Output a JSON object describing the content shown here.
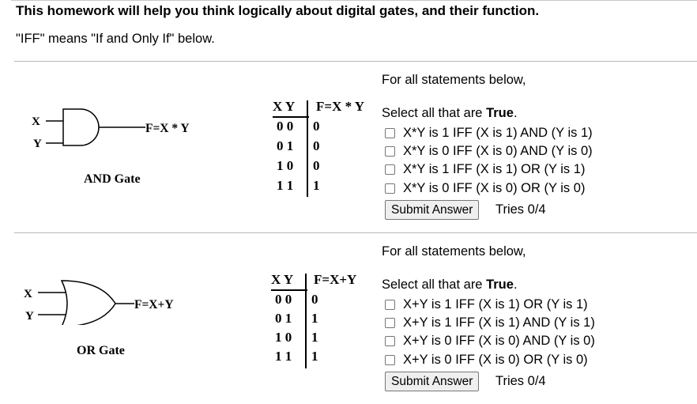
{
  "header": {
    "title": "This homework will help you think logically about digital gates, and their function.",
    "iff_note": "\"IFF\" means \"If and Only If\" below."
  },
  "problems": [
    {
      "gate_label": "AND Gate",
      "input_x": "X",
      "input_y": "Y",
      "output_label": "F=X * Y",
      "truth_table": {
        "header_inputs": "X Y",
        "header_output": "F=X * Y",
        "rows": [
          {
            "inputs": "0 0",
            "output": "0"
          },
          {
            "inputs": "0 1",
            "output": "0"
          },
          {
            "inputs": "1 0",
            "output": "0"
          },
          {
            "inputs": "1 1",
            "output": "1"
          }
        ]
      },
      "intro": "For all statements below,",
      "prompt_prefix": "Select all that are ",
      "prompt_bold": "True",
      "prompt_suffix": ".",
      "options": [
        "X*Y is 1 IFF (X is 1) AND (Y is 1)",
        "X*Y is 0 IFF (X is 0) AND (Y is 0)",
        "X*Y is 1 IFF (X is 1) OR (Y is 1)",
        "X*Y is 0 IFF (X is 0) OR (Y is 0)"
      ],
      "submit_label": "Submit Answer",
      "tries": "Tries 0/4"
    },
    {
      "gate_label": "OR Gate",
      "input_x": "X",
      "input_y": "Y",
      "output_label": "F=X+Y",
      "truth_table": {
        "header_inputs": "X Y",
        "header_output": "F=X+Y",
        "rows": [
          {
            "inputs": "0 0",
            "output": "0"
          },
          {
            "inputs": "0 1",
            "output": "1"
          },
          {
            "inputs": "1 0",
            "output": "1"
          },
          {
            "inputs": "1 1",
            "output": "1"
          }
        ]
      },
      "intro": "For all statements below,",
      "prompt_prefix": "Select all that are ",
      "prompt_bold": "True",
      "prompt_suffix": ".",
      "options": [
        "X+Y is 1 IFF (X is 1) OR (Y is 1)",
        "X+Y is 1 IFF (X is 1) AND (Y is 1)",
        "X+Y is 0 IFF (X is 0) AND (Y is 0)",
        "X+Y is 0 IFF (X is 0) OR (Y is 0)"
      ],
      "submit_label": "Submit Answer",
      "tries": "Tries 0/4"
    }
  ]
}
